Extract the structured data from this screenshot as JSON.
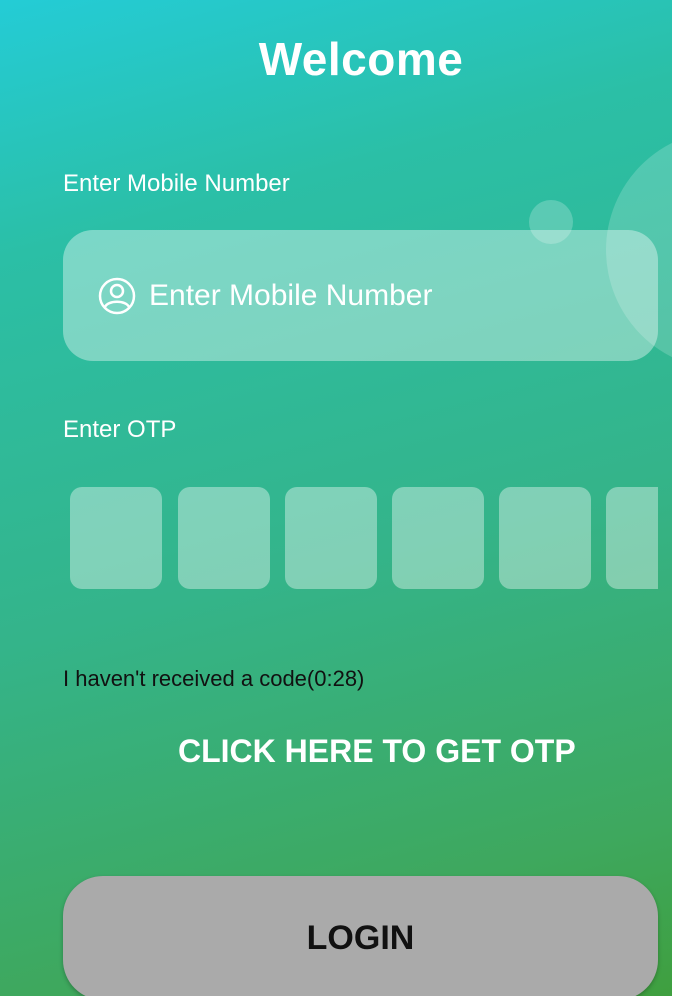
{
  "header": {
    "title": "Welcome"
  },
  "mobile": {
    "label": "Enter Mobile Number",
    "placeholder": "Enter Mobile Number",
    "icon": "user-icon"
  },
  "otp": {
    "label": "Enter OTP",
    "box_count": 6,
    "values": [
      "",
      "",
      "",
      "",
      "",
      ""
    ]
  },
  "resend": {
    "text": "I haven't received a code(0:28)",
    "get_otp_label": "CLICK HERE TO GET OTP"
  },
  "login": {
    "label": "LOGIN"
  },
  "colors": {
    "gradient_top": "#24ccd6",
    "gradient_bottom": "#3f9f3f",
    "login_button": "#aaaaaa",
    "field_overlay": "rgba(255,255,255,0.38)"
  }
}
